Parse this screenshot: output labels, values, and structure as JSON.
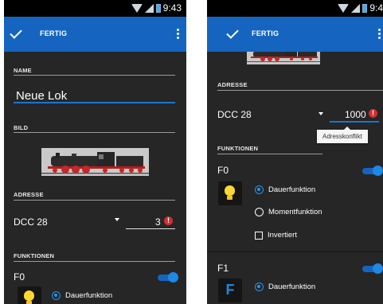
{
  "screen1": {
    "status": {
      "time": "9:43"
    },
    "appbar": {
      "title": "FERTIG"
    },
    "name_section": {
      "label": "NAME",
      "value": "Neue Lok"
    },
    "image_section": {
      "label": "BILD"
    },
    "address_section": {
      "label": "ADRESSE",
      "protocol": "DCC 28",
      "value": "3",
      "error_icon": "!"
    },
    "functions_section": {
      "label": "FUNKTIONEN",
      "functions": [
        {
          "name": "F0",
          "icon": "bulb-icon",
          "options": [
            "Dauerfunktion"
          ]
        }
      ]
    }
  },
  "screen2": {
    "status": {
      "time": "9:4"
    },
    "appbar": {
      "title": "FERTIG"
    },
    "address_section": {
      "label": "ADRESSE",
      "protocol": "DCC 28",
      "value": "1000",
      "error_icon": "!",
      "tooltip": "Adresskonflikt"
    },
    "functions_section": {
      "label": "FUNKTIONEN",
      "functions": [
        {
          "name": "F0",
          "icon": "bulb-icon",
          "options": [
            "Dauerfunktion",
            "Momentfunktion"
          ],
          "checkbox": "Invertiert"
        },
        {
          "name": "F1",
          "icon_letter": "F",
          "options": [
            "Dauerfunktion"
          ]
        }
      ]
    }
  },
  "colors": {
    "appbar": "#1565c0",
    "background": "#262626",
    "accent": "#2196f3",
    "error": "#d32f2f"
  }
}
